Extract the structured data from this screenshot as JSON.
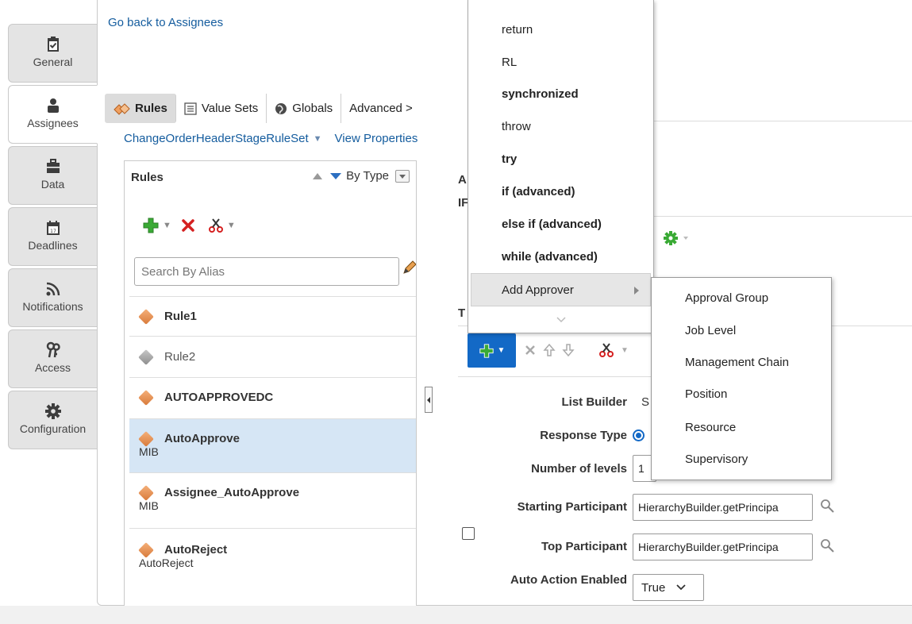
{
  "tabs": [
    {
      "label": "General",
      "icon": "clipboard-check-icon"
    },
    {
      "label": "Assignees",
      "icon": "person-icon"
    },
    {
      "label": "Data",
      "icon": "briefcase-icon"
    },
    {
      "label": "Deadlines",
      "icon": "calendar-icon"
    },
    {
      "label": "Notifications",
      "icon": "rss-icon"
    },
    {
      "label": "Access",
      "icon": "keys-icon"
    },
    {
      "label": "Configuration",
      "icon": "gear-icon"
    }
  ],
  "active_tab": "Assignees",
  "back_link": "Go back to Assignees",
  "rule_tabs": [
    {
      "label": "Rules",
      "active": true
    },
    {
      "label": "Value Sets",
      "active": false
    },
    {
      "label": "Globals",
      "active": false
    },
    {
      "label": "Advanced >",
      "active": false
    }
  ],
  "ruleset": {
    "name": "ChangeOrderHeaderStageRuleSet",
    "view_properties": "View Properties"
  },
  "rules_panel": {
    "header": "Rules",
    "sort_label": "By Type",
    "search_placeholder": "Search By Alias",
    "rules": [
      {
        "name": "Rule1",
        "sub": "",
        "active": true,
        "selected": false
      },
      {
        "name": "Rule2",
        "sub": "",
        "active": false,
        "selected": false
      },
      {
        "name": "AUTOAPPROVEDC",
        "sub": "",
        "active": true,
        "selected": false
      },
      {
        "name": "AutoApprove",
        "sub": "MIB",
        "active": true,
        "selected": true
      },
      {
        "name": "Assignee_AutoApprove",
        "sub": "MIB",
        "active": true,
        "selected": false
      },
      {
        "name": "AutoReject",
        "sub": "AutoReject",
        "active": true,
        "selected": false
      }
    ]
  },
  "detail": {
    "partial_a": "A",
    "partial_s": "s",
    "partial_if": "IF",
    "partial_t": "T",
    "list_builder": {
      "label": "List Builder",
      "value": "S"
    },
    "response_type": {
      "label": "Response Type"
    },
    "number_of_levels": {
      "label": "Number of levels",
      "value": "1"
    },
    "starting_participant": {
      "label": "Starting Participant",
      "value": "HierarchyBuilder.getPrincipa"
    },
    "top_participant": {
      "label": "Top Participant",
      "value": "HierarchyBuilder.getPrincipa"
    },
    "auto_action_enabled": {
      "label": "Auto Action Enabled",
      "value": "True"
    }
  },
  "menu": {
    "items": [
      {
        "label": "return",
        "bold": false
      },
      {
        "label": "RL",
        "bold": false
      },
      {
        "label": "synchronized",
        "bold": true
      },
      {
        "label": "throw",
        "bold": false
      },
      {
        "label": "try",
        "bold": true
      },
      {
        "label": "if (advanced)",
        "bold": true
      },
      {
        "label": "else if (advanced)",
        "bold": true
      },
      {
        "label": "while (advanced)",
        "bold": true
      }
    ],
    "add_approver": "Add Approver"
  },
  "submenu": {
    "items": [
      "Approval Group",
      "Job Level",
      "Management Chain",
      "Position",
      "Resource",
      "Supervisory"
    ]
  },
  "colors": {
    "accent": "#1369c6",
    "link": "#145c9e",
    "selected_row": "#d6e6f5",
    "rule_icon": "#d87a3a"
  }
}
